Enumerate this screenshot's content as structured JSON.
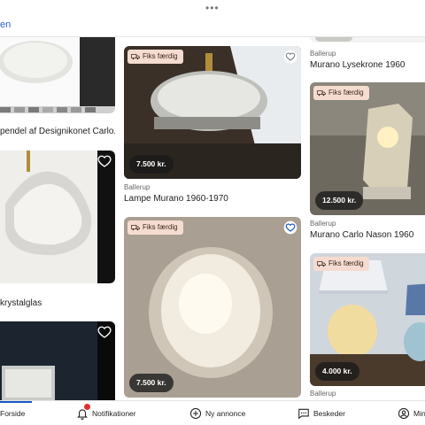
{
  "header": {
    "menu_dots": "•••",
    "back_label": "en"
  },
  "column_left": {
    "items": [
      {
        "title": "pendel af Designikonet Carlo...",
        "heart": "outline"
      },
      {
        "title": "krystalglas",
        "heart": "outline"
      },
      {
        "title": "",
        "heart": "outline"
      }
    ]
  },
  "column_middle": {
    "items": [
      {
        "badge": "Fiks færdig",
        "price": "7.500 kr.",
        "location": "Ballerup",
        "title": "Lampe Murano 1960-1970",
        "heart": "outline"
      },
      {
        "badge": "Fiks færdig",
        "price": "7.500 kr.",
        "location": "",
        "title": "",
        "heart": "filled"
      }
    ]
  },
  "column_right": {
    "items": [
      {
        "badge": "",
        "price": "",
        "location": "Ballerup",
        "title": "Murano Lysekrone 1960"
      },
      {
        "badge": "Fiks færdig",
        "price": "12.500 kr.",
        "location": "Ballerup",
        "title": "Murano Carlo Nason 1960"
      },
      {
        "badge": "Fiks færdig",
        "price": "4.000 kr.",
        "location": "Ballerup",
        "title": ""
      }
    ]
  },
  "bottom_nav": {
    "items": [
      {
        "label": "Forside",
        "icon": "home-icon",
        "active": true
      },
      {
        "label": "Notifikationer",
        "icon": "bell-icon",
        "badge": true
      },
      {
        "label": "Ny annonce",
        "icon": "plus-circle-icon"
      },
      {
        "label": "Beskeder",
        "icon": "chat-icon"
      },
      {
        "label": "Min",
        "icon": "profile-icon"
      }
    ]
  },
  "colors": {
    "accent": "#1a56c6",
    "badge_bg": "#f6dcd0",
    "notification": "#e03131"
  }
}
